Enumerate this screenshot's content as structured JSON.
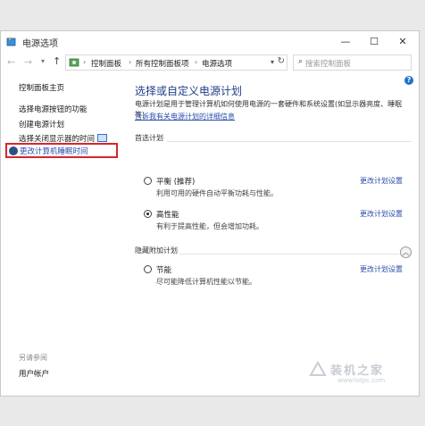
{
  "window": {
    "title": "电源选项",
    "controls": {
      "minimize": "—",
      "maximize": "☐",
      "close": "✕"
    }
  },
  "navbar": {
    "back": "←",
    "forward": "→",
    "up": "↑",
    "breadcrumbs": [
      "控制面板",
      "所有控制面板项",
      "电源选项"
    ],
    "search_placeholder": "搜索控制面板"
  },
  "help": "?",
  "sidebar": {
    "home": "控制面板主页",
    "items": [
      {
        "label": "选择电源按钮的功能"
      },
      {
        "label": "创建电源计划"
      },
      {
        "label": "选择关闭显示器的时间"
      },
      {
        "label": "更改计算机睡眠时间",
        "highlighted": true
      }
    ],
    "see_also": "另请参阅",
    "user_accounts": "用户帐户"
  },
  "main": {
    "title": "选择或自定义电源计划",
    "description": "电源计划是用于管理计算机如何使用电源的一套硬件和系统设置(如显示器亮度、睡眠等)",
    "learn_more": "告诉我有关电源计划的详细信息",
    "preferred_label": "首选计划",
    "hidden_label": "隐藏附加计划",
    "change_label": "更改计划设置",
    "plans": [
      {
        "name": "平衡 (推荐)",
        "desc": "利用可用的硬件自动平衡功耗与性能。",
        "selected": false
      },
      {
        "name": "高性能",
        "desc": "有利于提高性能，但会增加功耗。",
        "selected": true
      },
      {
        "name": "节能",
        "desc": "尽可能降低计算机性能以节能。",
        "selected": false
      }
    ]
  },
  "watermark": {
    "text": "装机之家",
    "url": "www.lotpc.com"
  },
  "colors": {
    "link": "#2a4da8",
    "title": "#1f3c88",
    "highlight_box": "#d6262d"
  }
}
